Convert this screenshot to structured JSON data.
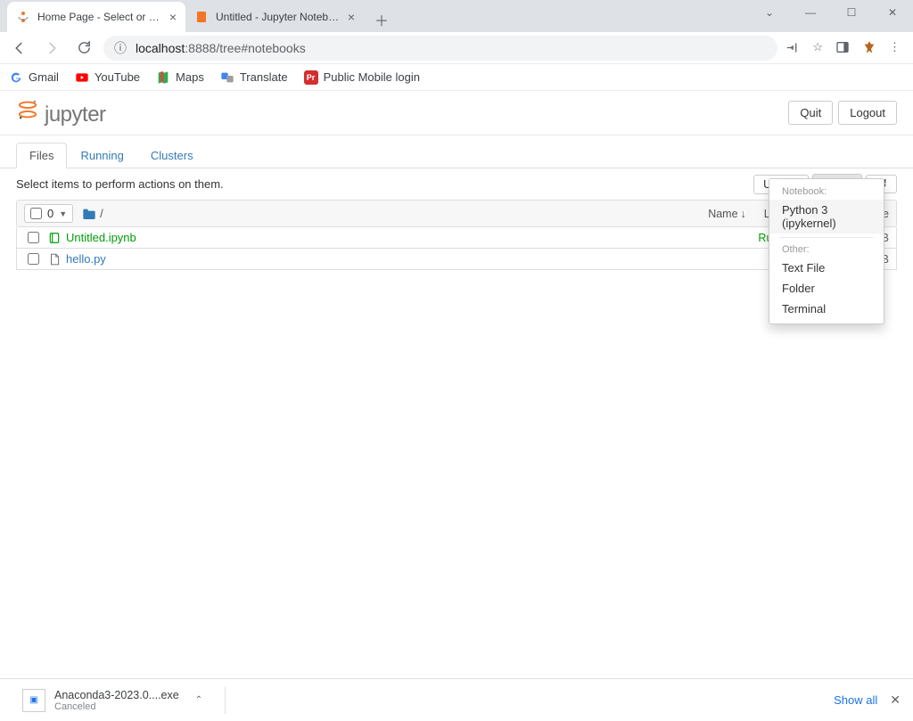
{
  "window": {
    "min": "—",
    "max": "☐",
    "close": "✕",
    "caret": "⌄"
  },
  "browser": {
    "tabs": [
      {
        "title": "Home Page - Select or create a n…"
      },
      {
        "title": "Untitled - Jupyter Notebook"
      }
    ],
    "url_host": "localhost",
    "url_port": ":8888",
    "url_path": "/tree#notebooks"
  },
  "bookmarks": [
    {
      "label": "Gmail"
    },
    {
      "label": "YouTube"
    },
    {
      "label": "Maps"
    },
    {
      "label": "Translate"
    },
    {
      "label": "Public Mobile login"
    }
  ],
  "jupyter": {
    "logo_text": "jupyter",
    "quit": "Quit",
    "logout": "Logout",
    "tabs": {
      "files": "Files",
      "running": "Running",
      "clusters": "Clusters"
    },
    "prompt": "Select items to perform actions on them.",
    "upload": "Upload",
    "new": "New",
    "select_count": "0",
    "crumb_root": "/",
    "cols": {
      "name": "Name",
      "mod": "Last Modified",
      "size": "File size"
    },
    "rows": [
      {
        "name": "Untitled.ipynb",
        "status": "Running",
        "size": "72 B",
        "running": true,
        "icon": "book"
      },
      {
        "name": "hello.py",
        "status": "",
        "size": "22 B",
        "running": false,
        "icon": "file"
      }
    ],
    "new_menu": {
      "h1": "Notebook:",
      "python": "Python 3 (ipykernel)",
      "h2": "Other:",
      "textfile": "Text File",
      "folder": "Folder",
      "terminal": "Terminal"
    }
  },
  "download": {
    "file": "Anaconda3-2023.0....exe",
    "status": "Canceled",
    "showall": "Show all"
  }
}
